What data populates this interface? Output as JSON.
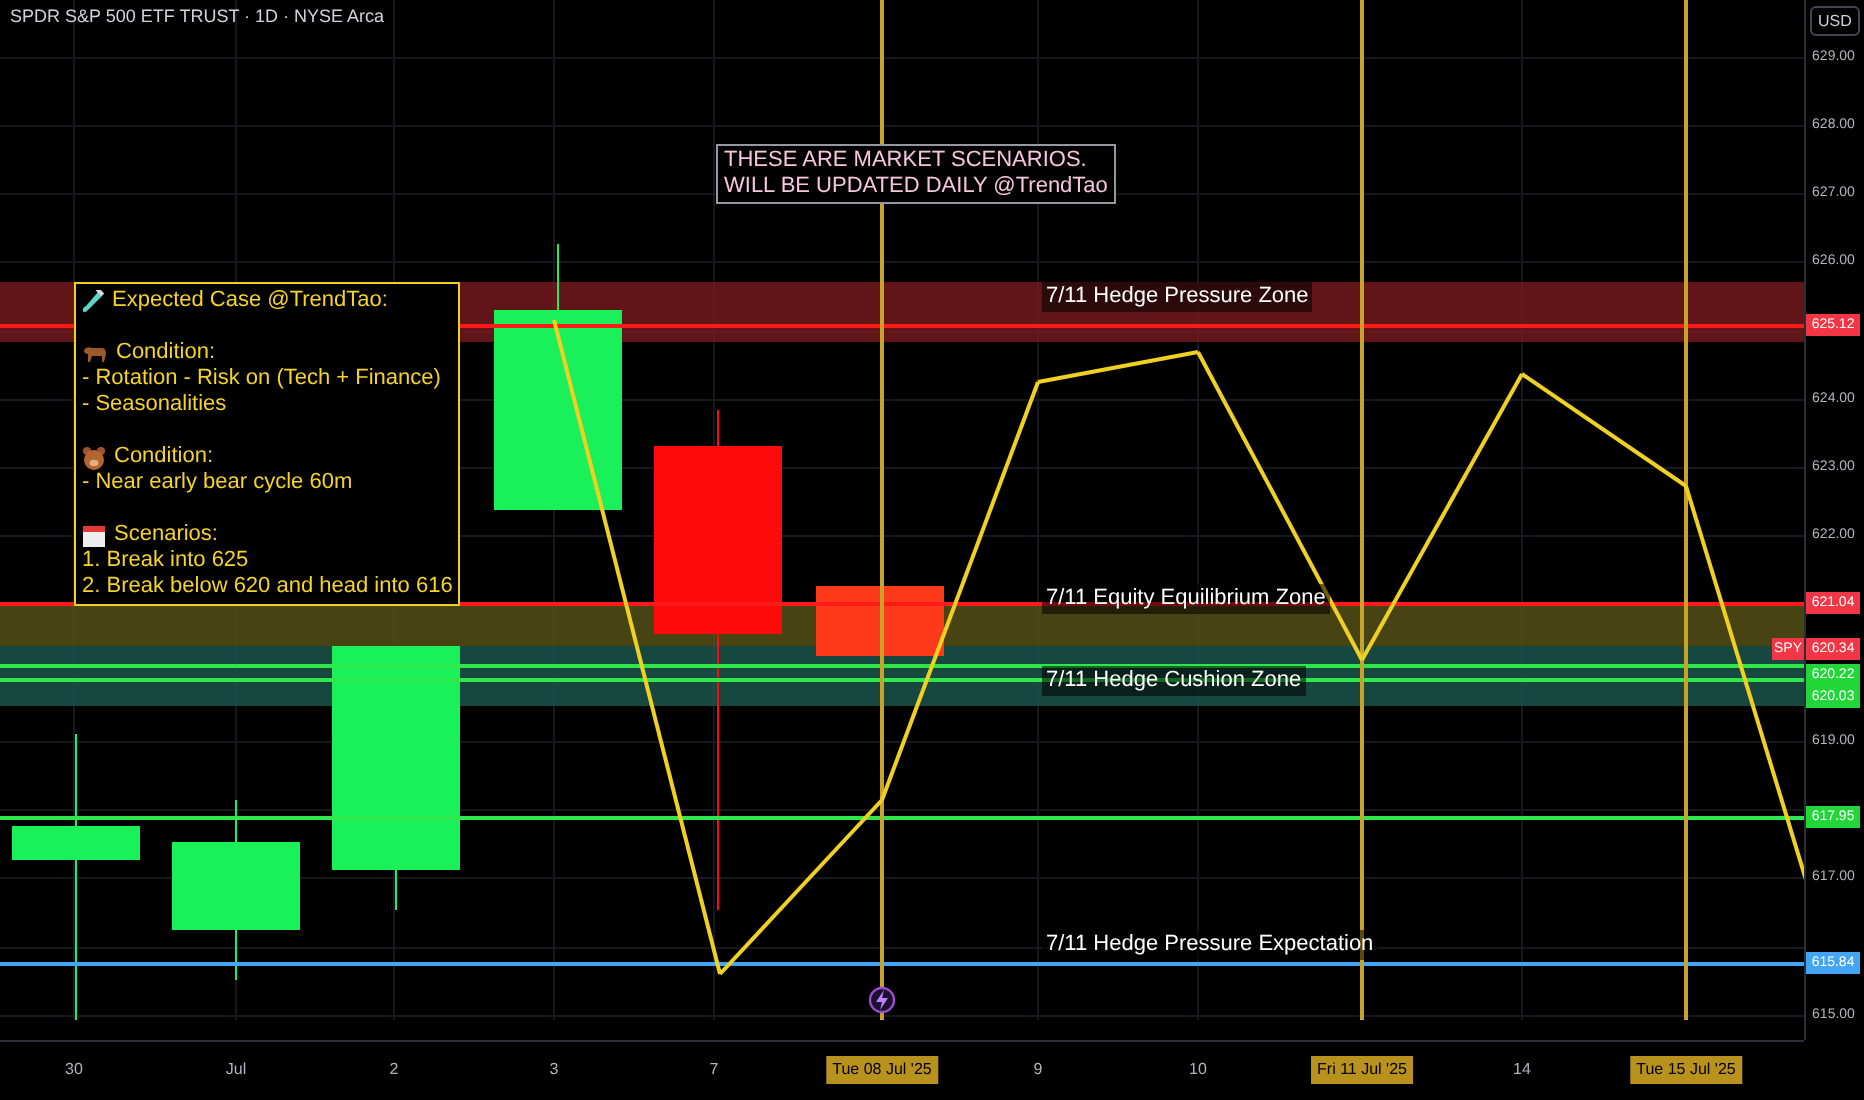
{
  "header": {
    "title": "SPDR S&P 500 ETF TRUST · 1D · NYSE Arca"
  },
  "price_axis": {
    "currency": "USD",
    "ticks": [
      "629.00",
      "628.00",
      "627.00",
      "626.00",
      "624.00",
      "623.00",
      "622.00",
      "619.00",
      "617.00",
      "615.00"
    ],
    "tags": [
      {
        "label": "625.12",
        "color": "#f23645"
      },
      {
        "label": "621.04",
        "color": "#f23645"
      },
      {
        "label": "620.34",
        "color": "#f23645",
        "symbol": "SPY"
      },
      {
        "label": "620.22",
        "color": "#22d63a"
      },
      {
        "label": "620.03",
        "color": "#22d63a"
      },
      {
        "label": "617.95",
        "color": "#22d63a"
      },
      {
        "label": "615.84",
        "color": "#42a5f5"
      }
    ]
  },
  "time_axis": [
    {
      "label": "30",
      "highlighted": false
    },
    {
      "label": "Jul",
      "highlighted": false
    },
    {
      "label": "2",
      "highlighted": false
    },
    {
      "label": "3",
      "highlighted": false
    },
    {
      "label": "7",
      "highlighted": false
    },
    {
      "label": "Tue 08 Jul '25",
      "highlighted": true
    },
    {
      "label": "9",
      "highlighted": false
    },
    {
      "label": "10",
      "highlighted": false
    },
    {
      "label": "Fri 11 Jul '25",
      "highlighted": true
    },
    {
      "label": "14",
      "highlighted": false
    },
    {
      "label": "Tue 15 Jul '25",
      "highlighted": true
    }
  ],
  "zones": [
    "7/11 Hedge Pressure Zone",
    "7/11 Equity Equilibrium Zone",
    "7/11 Hedge Cushion Zone",
    "7/11 Hedge Pressure Expectation"
  ],
  "note": [
    "THESE ARE MARKET SCENARIOS.",
    "WILL BE UPDATED DAILY @TrendTao"
  ],
  "annotation": [
    {
      "kind": "tube",
      "heading": "Expected Case @TrendTao:"
    },
    {
      "kind": "bull",
      "heading": "Condition:",
      "lines": [
        "- Rotation - Risk on (Tech + Finance)",
        "- Seasonalities"
      ]
    },
    {
      "kind": "bear",
      "heading": "Condition:",
      "lines": [
        "- Near early bear cycle 60m"
      ]
    },
    {
      "kind": "calendar",
      "heading": "Scenarios:",
      "lines": [
        "1. Break into 625",
        "2. Break below 620 and head into 616"
      ]
    }
  ]
}
